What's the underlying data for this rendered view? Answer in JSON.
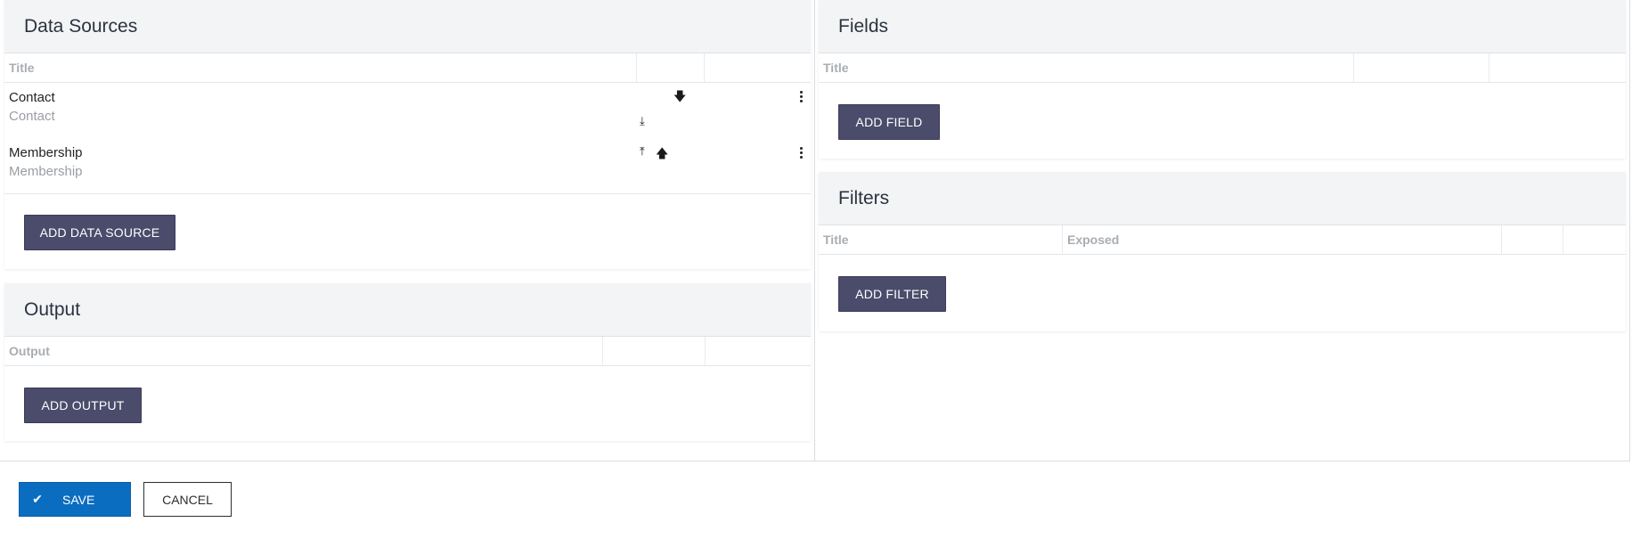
{
  "data_sources": {
    "title": "Data Sources",
    "columns": [
      "Title",
      "",
      ""
    ],
    "rows": [
      {
        "title": "Contact",
        "subtitle": "Contact",
        "icons": [
          "move-down-icon",
          "move-to-bottom-icon"
        ]
      },
      {
        "title": "Membership",
        "subtitle": "Membership",
        "icons": [
          "move-to-top-icon",
          "move-up-icon"
        ]
      }
    ],
    "add_label": "ADD DATA SOURCE"
  },
  "output": {
    "title": "Output",
    "columns": [
      "Output",
      "",
      ""
    ],
    "add_label": "ADD OUTPUT"
  },
  "fields": {
    "title": "Fields",
    "columns": [
      "Title",
      "",
      ""
    ],
    "add_label": "ADD FIELD"
  },
  "filters": {
    "title": "Filters",
    "columns": [
      "Title",
      "Exposed",
      "",
      ""
    ],
    "add_label": "ADD FILTER"
  },
  "footer": {
    "save_label": "SAVE",
    "cancel_label": "CANCEL"
  },
  "colors": {
    "primary": "#0b6dc0",
    "button_dark": "#4b4b6b",
    "panel_header": "#f2f4f6"
  }
}
